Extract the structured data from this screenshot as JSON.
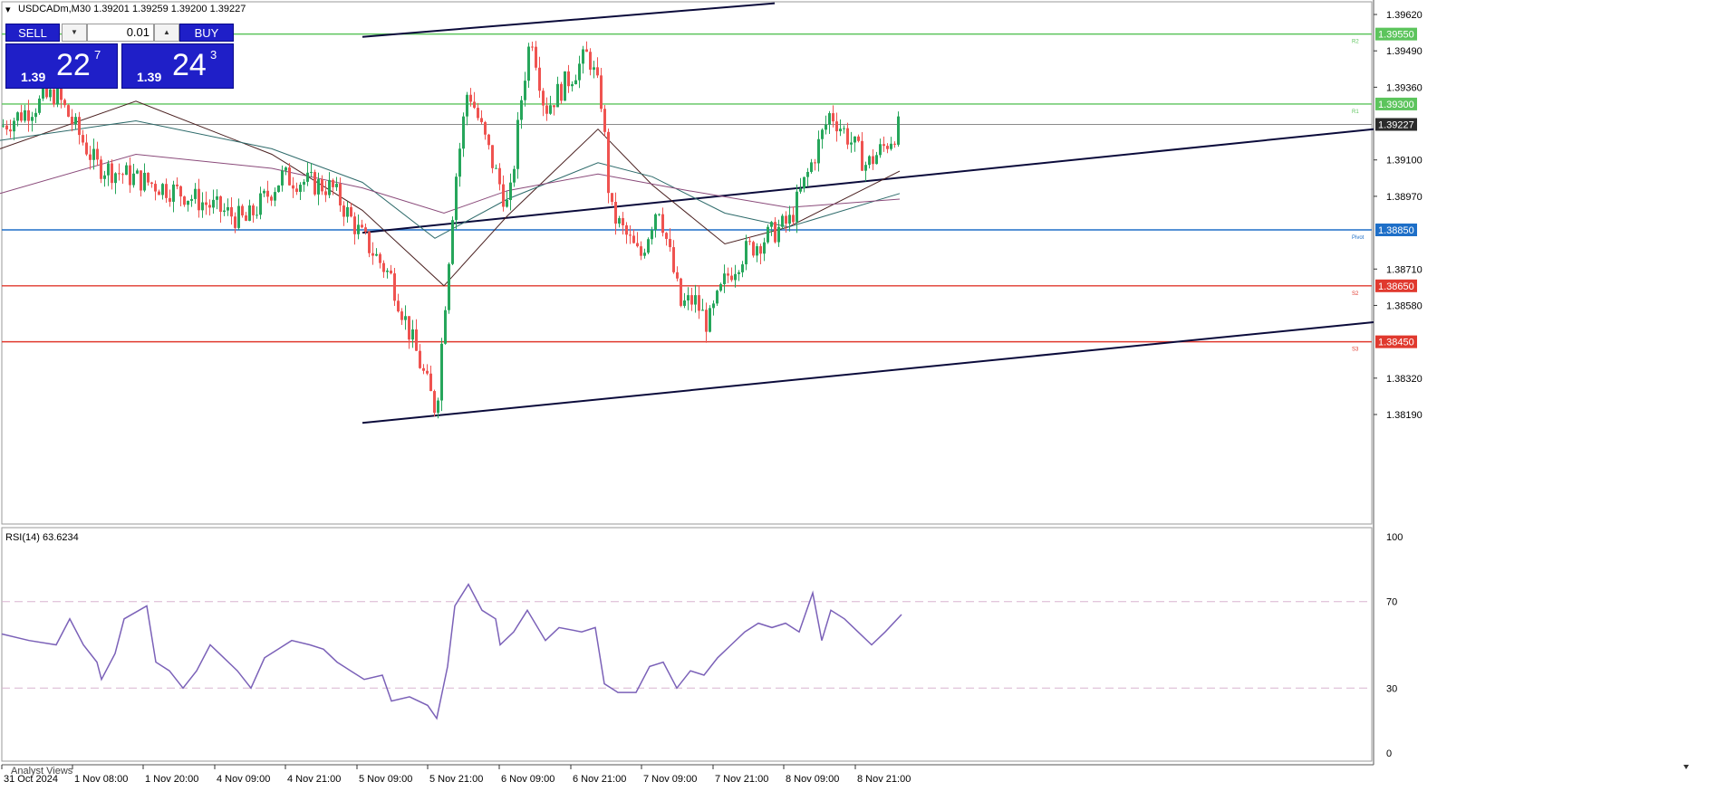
{
  "header": {
    "symbol_line": "USDCADm,M30  1.39201 1.39259 1.39200 1.39227"
  },
  "trade_panel": {
    "sell_label": "SELL",
    "buy_label": "BUY",
    "lot_value": "0.01",
    "bid": {
      "prefix": "1.39",
      "big": "22",
      "sup": "7"
    },
    "ask": {
      "prefix": "1.39",
      "big": "24",
      "sup": "3"
    }
  },
  "rsi_panel": {
    "title": "RSI(14) 63.6234"
  },
  "bottom_tab": {
    "label": "Analyst Views"
  },
  "colors": {
    "bull": "#26a65b",
    "bear": "#ef5350",
    "resistance": "#5cc45c",
    "pivot": "#1e6fc8",
    "support": "#e0392e",
    "current": "#2b2b2b",
    "channel": "#0b0b3b",
    "rsi": "#7b61b8"
  },
  "chart_data": [
    {
      "type": "candlestick",
      "symbol": "USDCADm",
      "timeframe": "M30",
      "ohlc_header": {
        "open": 1.39201,
        "high": 1.39259,
        "low": 1.392,
        "close": 1.39227
      },
      "y_ticks": [
        1.3962,
        1.3949,
        1.3936,
        1.391,
        1.3897,
        1.3871,
        1.3858,
        1.3832,
        1.3819
      ],
      "ylim": [
        1.3813,
        1.3965
      ],
      "x_tick_labels": [
        "31 Oct 2024",
        "1 Nov 08:00",
        "1 Nov 20:00",
        "4 Nov 09:00",
        "4 Nov 21:00",
        "5 Nov 09:00",
        "5 Nov 21:00",
        "6 Nov 09:00",
        "6 Nov 21:00",
        "7 Nov 09:00",
        "7 Nov 21:00",
        "8 Nov 09:00",
        "8 Nov 21:00"
      ],
      "current_price": 1.39227,
      "levels": [
        {
          "name": "R2",
          "value": 1.3955,
          "role": "resistance"
        },
        {
          "name": "R1",
          "value": 1.393,
          "role": "resistance"
        },
        {
          "name": "Pivot",
          "value": 1.3885,
          "role": "pivot"
        },
        {
          "name": "S2",
          "value": 1.3865,
          "role": "support"
        },
        {
          "name": "S3",
          "value": 1.3845,
          "role": "support"
        }
      ],
      "level_labels": [
        "1.39550",
        "1.39300",
        "1.39227",
        "1.38850",
        "1.38650",
        "1.38450"
      ],
      "key_points": [
        {
          "x": 0,
          "price": 1.3922
        },
        {
          "x": 60,
          "price": 1.3934
        },
        {
          "x": 105,
          "price": 1.3908
        },
        {
          "x": 200,
          "price": 1.3898
        },
        {
          "x": 270,
          "price": 1.3888
        },
        {
          "x": 310,
          "price": 1.3904
        },
        {
          "x": 365,
          "price": 1.39
        },
        {
          "x": 395,
          "price": 1.3884
        },
        {
          "x": 430,
          "price": 1.3868
        },
        {
          "x": 480,
          "price": 1.382
        },
        {
          "x": 500,
          "price": 1.39
        },
        {
          "x": 515,
          "price": 1.3936
        },
        {
          "x": 545,
          "price": 1.3906
        },
        {
          "x": 560,
          "price": 1.3892
        },
        {
          "x": 575,
          "price": 1.3935
        },
        {
          "x": 585,
          "price": 1.3956
        },
        {
          "x": 600,
          "price": 1.3928
        },
        {
          "x": 648,
          "price": 1.3948
        },
        {
          "x": 663,
          "price": 1.393
        },
        {
          "x": 672,
          "price": 1.3892
        },
        {
          "x": 705,
          "price": 1.3875
        },
        {
          "x": 725,
          "price": 1.3895
        },
        {
          "x": 750,
          "price": 1.3858
        },
        {
          "x": 765,
          "price": 1.386
        },
        {
          "x": 780,
          "price": 1.3851
        },
        {
          "x": 800,
          "price": 1.3868
        },
        {
          "x": 820,
          "price": 1.3877
        },
        {
          "x": 870,
          "price": 1.3888
        },
        {
          "x": 890,
          "price": 1.3905
        },
        {
          "x": 915,
          "price": 1.3927
        },
        {
          "x": 935,
          "price": 1.3918
        },
        {
          "x": 955,
          "price": 1.3908
        },
        {
          "x": 975,
          "price": 1.3915
        },
        {
          "x": 993,
          "price": 1.39227
        }
      ],
      "channel_lines": [
        {
          "from": {
            "x": 400,
            "price": 1.3954
          },
          "to": {
            "x": 855,
            "price": 1.3966
          }
        },
        {
          "from": {
            "x": 400,
            "price": 1.3884
          },
          "to": {
            "x": 1516,
            "price": 1.3921
          }
        },
        {
          "from": {
            "x": 400,
            "price": 1.3816
          },
          "to": {
            "x": 1516,
            "price": 1.3852
          }
        }
      ],
      "moving_averages": [
        {
          "color": "#4a2020",
          "points": [
            [
              0,
              1.3914
            ],
            [
              150,
              1.3931
            ],
            [
              300,
              1.3912
            ],
            [
              400,
              1.3892
            ],
            [
              490,
              1.3865
            ],
            [
              560,
              1.389
            ],
            [
              660,
              1.3921
            ],
            [
              720,
              1.3901
            ],
            [
              800,
              1.388
            ],
            [
              870,
              1.3886
            ],
            [
              993,
              1.3906
            ]
          ]
        },
        {
          "color": "#2d6a6a",
          "points": [
            [
              0,
              1.3917
            ],
            [
              150,
              1.3924
            ],
            [
              300,
              1.3914
            ],
            [
              400,
              1.3902
            ],
            [
              480,
              1.3882
            ],
            [
              560,
              1.3896
            ],
            [
              660,
              1.3909
            ],
            [
              720,
              1.3904
            ],
            [
              800,
              1.3891
            ],
            [
              870,
              1.3886
            ],
            [
              993,
              1.3898
            ]
          ]
        },
        {
          "color": "#8a4a7a",
          "points": [
            [
              0,
              1.3898
            ],
            [
              150,
              1.3912
            ],
            [
              300,
              1.3907
            ],
            [
              400,
              1.39
            ],
            [
              490,
              1.3891
            ],
            [
              560,
              1.3899
            ],
            [
              660,
              1.3905
            ],
            [
              760,
              1.3899
            ],
            [
              870,
              1.3893
            ],
            [
              993,
              1.3896
            ]
          ]
        }
      ]
    },
    {
      "type": "line",
      "name": "RSI(14)",
      "current_value": 63.6234,
      "ylim": [
        0,
        100
      ],
      "y_ticks": [
        100,
        70,
        30,
        0
      ],
      "guide_levels": [
        70,
        30
      ],
      "points": [
        [
          0,
          55
        ],
        [
          30,
          52
        ],
        [
          60,
          50
        ],
        [
          75,
          62
        ],
        [
          90,
          50
        ],
        [
          105,
          42
        ],
        [
          110,
          34
        ],
        [
          125,
          46
        ],
        [
          135,
          62
        ],
        [
          160,
          68
        ],
        [
          170,
          42
        ],
        [
          185,
          38
        ],
        [
          200,
          30
        ],
        [
          215,
          38
        ],
        [
          230,
          50
        ],
        [
          245,
          44
        ],
        [
          260,
          38
        ],
        [
          275,
          30
        ],
        [
          290,
          44
        ],
        [
          305,
          48
        ],
        [
          320,
          52
        ],
        [
          340,
          50
        ],
        [
          355,
          48
        ],
        [
          370,
          42
        ],
        [
          385,
          38
        ],
        [
          400,
          34
        ],
        [
          420,
          36
        ],
        [
          430,
          24
        ],
        [
          450,
          26
        ],
        [
          470,
          22
        ],
        [
          480,
          16
        ],
        [
          492,
          40
        ],
        [
          500,
          68
        ],
        [
          515,
          78
        ],
        [
          530,
          66
        ],
        [
          545,
          62
        ],
        [
          550,
          50
        ],
        [
          565,
          56
        ],
        [
          580,
          66
        ],
        [
          600,
          52
        ],
        [
          615,
          58
        ],
        [
          640,
          56
        ],
        [
          655,
          58
        ],
        [
          665,
          32
        ],
        [
          680,
          28
        ],
        [
          700,
          28
        ],
        [
          715,
          40
        ],
        [
          730,
          42
        ],
        [
          745,
          30
        ],
        [
          760,
          38
        ],
        [
          775,
          36
        ],
        [
          790,
          44
        ],
        [
          805,
          50
        ],
        [
          820,
          56
        ],
        [
          835,
          60
        ],
        [
          850,
          58
        ],
        [
          865,
          60
        ],
        [
          880,
          56
        ],
        [
          895,
          74
        ],
        [
          905,
          52
        ],
        [
          915,
          66
        ],
        [
          930,
          62
        ],
        [
          945,
          56
        ],
        [
          960,
          50
        ],
        [
          975,
          56
        ],
        [
          993,
          64
        ]
      ]
    }
  ]
}
